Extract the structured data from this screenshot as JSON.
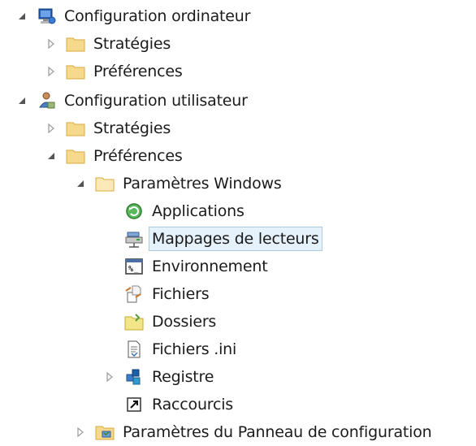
{
  "tree": {
    "computer_config": {
      "label": "Configuration ordinateur"
    },
    "computer_strategies": {
      "label": "Stratégies"
    },
    "computer_preferences": {
      "label": "Préférences"
    },
    "user_config": {
      "label": "Configuration utilisateur"
    },
    "user_strategies": {
      "label": "Stratégies"
    },
    "user_preferences": {
      "label": "Préférences"
    },
    "windows_settings": {
      "label": "Paramètres Windows"
    },
    "items": [
      {
        "label": "Applications",
        "icon": "applications-icon"
      },
      {
        "label": "Mappages de lecteurs",
        "icon": "drive-map-icon",
        "selected": true
      },
      {
        "label": "Environnement",
        "icon": "environment-icon"
      },
      {
        "label": "Fichiers",
        "icon": "files-icon"
      },
      {
        "label": "Dossiers",
        "icon": "folders-icon"
      },
      {
        "label": "Fichiers .ini",
        "icon": "ini-file-icon"
      },
      {
        "label": "Registre",
        "icon": "registry-icon"
      },
      {
        "label": "Raccourcis",
        "icon": "shortcut-icon"
      }
    ],
    "control_panel_settings": {
      "label": "Paramètres du Panneau de configuration"
    }
  },
  "colors": {
    "folder_fill": "#f6d98c",
    "folder_edge": "#d9a93b",
    "selection_bg": "#e5f1fb",
    "selection_border": "#a8cbe8",
    "arrow_open": "#555555",
    "arrow_closed": "#a0a0a0"
  }
}
